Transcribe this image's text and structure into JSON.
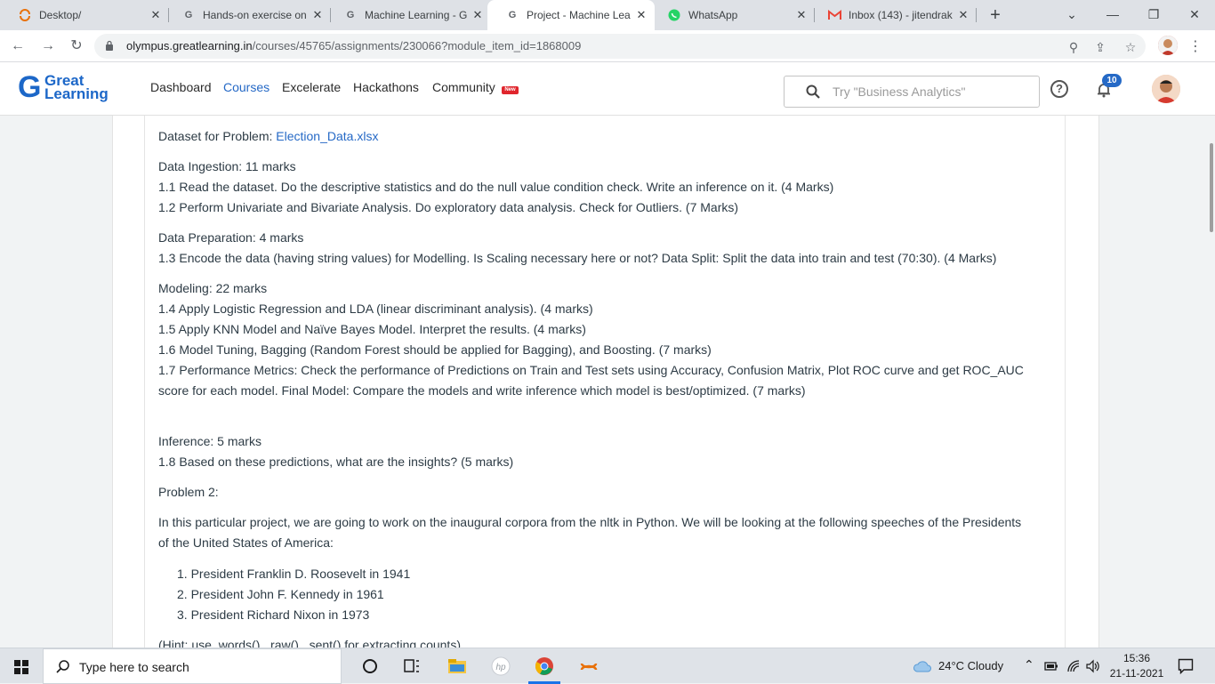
{
  "browser": {
    "tabs": [
      {
        "title": "Desktop/",
        "favicon": "app-refresh-icon"
      },
      {
        "title": "Hands-on exercise on",
        "favicon": "great-learning-icon"
      },
      {
        "title": "Machine Learning - G",
        "favicon": "great-learning-icon"
      },
      {
        "title": "Project - Machine Lea",
        "favicon": "great-learning-icon",
        "active": true
      },
      {
        "title": "WhatsApp",
        "favicon": "whatsapp-icon"
      },
      {
        "title": "Inbox (143) - jitendrak",
        "favicon": "gmail-icon"
      }
    ],
    "url_host": "olympus.greatlearning.in",
    "url_path": "/courses/45765/assignments/230066?module_item_id=1868009"
  },
  "header": {
    "logo_line1": "Great",
    "logo_line2": "Learning",
    "nav": [
      "Dashboard",
      "Courses",
      "Excelerate",
      "Hackathons",
      "Community"
    ],
    "new_badge": "New",
    "search_placeholder": "Try \"Business Analytics\"",
    "notifications_count": "10",
    "accent": "#2569c6"
  },
  "content": {
    "dataset_label": "Dataset for Problem: ",
    "dataset_link": "Election_Data.xlsx",
    "ingestion_title": "Data Ingestion: 11 marks",
    "q1_1": "1.1 Read the dataset. Do the descriptive statistics and do the null value condition check. Write an inference on it. (4 Marks)",
    "q1_2": "1.2 Perform Univariate and Bivariate Analysis. Do exploratory data analysis. Check for Outliers. (7 Marks)",
    "prep_title": "Data Preparation: 4 marks",
    "q1_3": "1.3 Encode the data (having string values) for Modelling. Is Scaling necessary here or not? Data Split: Split the data into train and test (70:30). (4 Marks)",
    "modeling_title": "Modeling: 22 marks",
    "q1_4": "1.4 Apply Logistic Regression and LDA (linear discriminant analysis). (4 marks)",
    "q1_5": "1.5 Apply KNN Model and Naïve Bayes Model. Interpret the results. (4 marks)",
    "q1_6": "1.6 Model Tuning, Bagging (Random Forest should be applied for Bagging), and Boosting. (7 marks)",
    "q1_7a": "1.7 Performance Metrics: Check the performance of Predictions on Train and Test sets using Accuracy, Confusion Matrix, Plot ROC curve and get ROC_AUC",
    "q1_7b": "score for each model. Final Model: Compare the models and write inference which model is best/optimized. (7 marks)",
    "inference_title": "Inference: 5 marks",
    "q1_8": "1.8 Based on these predictions, what are the insights? (5 marks)",
    "problem2": "Problem 2:",
    "p2_intro_a": "In this particular project, we are going to work on the inaugural corpora from the nltk in Python. We will be looking at the following speeches of the Presidents",
    "p2_intro_b": "of the United States of America:",
    "list": [
      "1. President Franklin D. Roosevelt in 1941",
      "2. President John F. Kennedy in 1961",
      "3. President Richard Nixon in 1973"
    ],
    "hint_partial": "(Hint: use .words(), .raw(), .sent() for extracting counts)"
  },
  "taskbar": {
    "search_text": "Type here to search",
    "weather": "24°C  Cloudy",
    "time": "15:36",
    "date": "21-11-2021"
  }
}
